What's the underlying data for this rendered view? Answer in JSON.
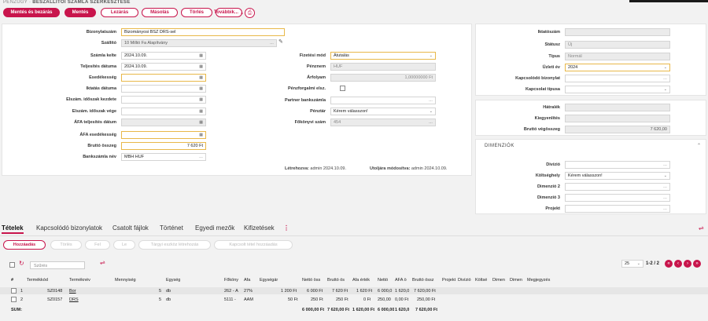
{
  "header": {
    "breadcrumb_root": "PÉNZÜGY",
    "breadcrumb_sep": " · ",
    "page_title": "BESZÁLLÍTÓI SZÁMLA SZERKESZTÉSE"
  },
  "toolbar": {
    "save_close": "Mentés és bezárás",
    "save": "Mentés",
    "lock": "Lezárás",
    "copy": "Másolás",
    "delete": "Törlés",
    "more": "További​k...",
    "more_arrow": "⌄"
  },
  "form": {
    "bizonylatszam_label": "Bizonylatszám",
    "bizonylatszam": "Bizományosi BSZ DRS-sel",
    "szallito_label": "Szállító",
    "szallito": "10 Millió Fa Alapítvány",
    "szamla_kelte_label": "Számla kelte",
    "szamla_kelte": "2024.10.09.",
    "teljesites_label": "Teljesítés dátuma",
    "teljesites": "2024.10.09.",
    "esedekesseg_label": "Esedékesség",
    "iktatas_label": "Iktatás dátuma",
    "elsz_kezdete_label": "Elszám. időszak kezdete",
    "elsz_vege_label": "Elszám. időszak vége",
    "afa_telj_label": "ÁFA teljesítés dátum",
    "afa_esed_label": "ÁFA esedékesség",
    "brutto_label": "Bruttó összeg",
    "brutto": "7 620 Ft",
    "bankszamla_label": "Bankszámla név",
    "bankszamla": "MBH HUF",
    "fizetesi_mod_label": "Fizetési mód",
    "fizetesi_mod": "Átutalás",
    "penznem_label": "Pénznem",
    "penznem": "HUF",
    "arfolyam_label": "Árfolyam",
    "arfolyam": "1,00000000 Ft",
    "penzforgalmi_label": "Pénzforgalmi elsz.",
    "partner_bank_label": "Partner bankszámla",
    "penztar_label": "Pénztár",
    "penztar": "Kérem válasszon!",
    "fokonyvi_label": "Főkönyvi szám",
    "fokonyvi": "454",
    "created_label": "Létrehozva:",
    "created": "admin 2024.10.09.",
    "modified_label": "Utoljára módosítva:",
    "modified": "admin 2024.10.09."
  },
  "side": {
    "iktatoszam_label": "Iktatószám",
    "statusz_label": "Státusz",
    "statusz": "Új",
    "tipus_label": "Típus",
    "tipus": "Normál",
    "uzleti_ev_label": "Üzleti év",
    "uzleti_ev": "2024",
    "kapcs_biz_label": "Kapcsolódó bizonylat",
    "kapcs_tipus_label": "Kapcsolat típusa",
    "hatralek_label": "Hátralék",
    "kiegyenlites_label": "Kiegyenlítés",
    "brutto_vegosszeg_label": "Bruttó végösszeg",
    "brutto_vegosszeg": "7 620,00",
    "dimenziok_title": "DIMENZIÓK",
    "divizio_label": "Divízió",
    "koltseghely_label": "Költséghely",
    "koltseghely": "Kérem válasszon!",
    "dim2_label": "Dimenzió 2",
    "dim3_label": "Dimenzió 3",
    "projekt_label": "Projekt"
  },
  "tabs": [
    "Tételek",
    "Kapcsolódó bizonylatok",
    "Csatolt fájlok",
    "Történet",
    "Egyedi mezők",
    "Kifizetések"
  ],
  "subtoolbar": {
    "add": "Hozzáadás",
    "delete": "Törlés",
    "up": "Fel",
    "down": "Le",
    "create_items": "Tárgyi eszköz létrehozás",
    "add_linked": "Kapcsolt tétel hozzáadás"
  },
  "grid": {
    "search_placeholder": "Szűrés",
    "page_size": "25",
    "page_info": "1-2 / 2",
    "columns": [
      "#",
      "Termékkód",
      "Terméknév",
      "Mennyiség",
      "Egység",
      "Főköny",
      "Áfa",
      "Egységár",
      "Nettó öss",
      "Bruttó ös",
      "Áfa érték",
      "Nettó",
      "ÁFA ö",
      "Bruttó össz",
      "Projekt",
      "Divízió",
      "Költsé",
      "Dimen",
      "Dimen",
      "Megjegyzés"
    ],
    "rows": [
      {
        "n": "1",
        "kod": "SZ0148",
        "nev": "Bor",
        "menny": "5",
        "egyseg": "db",
        "fokonyv": "262 - Á",
        "afa": "27%",
        "egysegar": "1 200 Ft",
        "netto": "6 000 Ft",
        "brutto": "7 620 Ft",
        "afa_ertek": "1 620 Ft",
        "netto2": "6 000,0",
        "afa2": "1 620,0",
        "brutto2": "7 620,00 Ft"
      },
      {
        "n": "2",
        "kod": "SZ0157",
        "nev": "DRS",
        "menny": "5",
        "egyseg": "db",
        "fokonyv": "5111 - ",
        "afa": "AAM",
        "egysegar": "50 Ft",
        "netto": "250 Ft",
        "brutto": "250 Ft",
        "afa_ertek": "0 Ft",
        "netto2": "250,00",
        "afa2": "0,00 Ft",
        "brutto2": "250,00 Ft"
      }
    ],
    "sum_label": "SUM:",
    "sum": {
      "netto": "6 000,00 Ft",
      "brutto": "7 620,00 Ft",
      "afa_ertek": "1 620,00 Ft",
      "netto2": "6 000,00",
      "afa2": "1 620,0",
      "brutto2": "7 620,00 Ft"
    }
  },
  "colors": {
    "accent": "#c8154c",
    "highlight_border": "#e8b84a"
  }
}
